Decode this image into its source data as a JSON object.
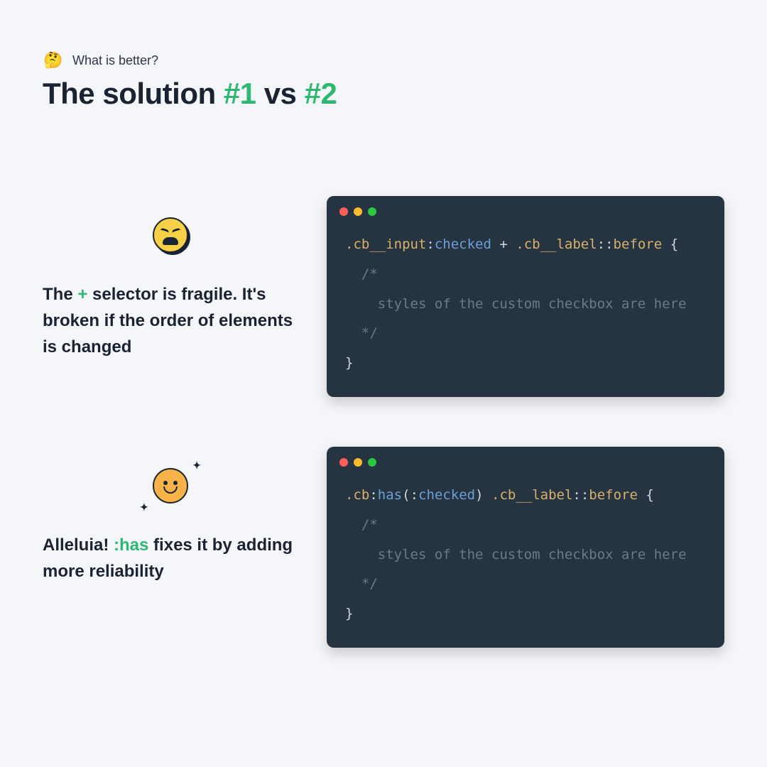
{
  "header": {
    "lead_emoji": "🤔",
    "lead_text": "What is better?",
    "title_pre": "The solution ",
    "title_num1": "#1",
    "title_mid": "  vs ",
    "title_num2": "#2"
  },
  "block1": {
    "face": "weary",
    "desc_1": "The ",
    "desc_accent": "+",
    "desc_2": " selector is fragile. It's broken if the order of elements is changed",
    "code_tokens": [
      {
        "t": ".cb__input",
        "c": "tok-sel"
      },
      {
        "t": ":",
        "c": "tok-op"
      },
      {
        "t": "checked",
        "c": "tok-pseudo"
      },
      {
        "t": " + ",
        "c": "tok-op"
      },
      {
        "t": ".cb__label",
        "c": "tok-sel"
      },
      {
        "t": "::",
        "c": "tok-op"
      },
      {
        "t": "before",
        "c": "tok-before"
      },
      {
        "t": " {",
        "c": "tok-op"
      }
    ],
    "code_comment_lines": [
      "  /*",
      "    styles of the custom checkbox are here",
      "  */"
    ],
    "code_close": "}"
  },
  "block2": {
    "face": "happy",
    "desc_1": "Alleluia! ",
    "desc_accent": ":has",
    "desc_2": " fixes it by adding more reliability",
    "code_tokens": [
      {
        "t": ".cb",
        "c": "tok-sel"
      },
      {
        "t": ":",
        "c": "tok-op"
      },
      {
        "t": "has",
        "c": "tok-pseudo"
      },
      {
        "t": "(",
        "c": "tok-op"
      },
      {
        "t": ":",
        "c": "tok-op"
      },
      {
        "t": "checked",
        "c": "tok-pseudo"
      },
      {
        "t": ")",
        "c": "tok-op"
      },
      {
        "t": " ",
        "c": "tok-op"
      },
      {
        "t": ".cb__label",
        "c": "tok-sel"
      },
      {
        "t": "::",
        "c": "tok-op"
      },
      {
        "t": "before",
        "c": "tok-before"
      },
      {
        "t": " {",
        "c": "tok-op"
      }
    ],
    "code_comment_lines": [
      "  /*",
      "    styles of the custom checkbox are here",
      "  */"
    ],
    "code_close": "}"
  }
}
